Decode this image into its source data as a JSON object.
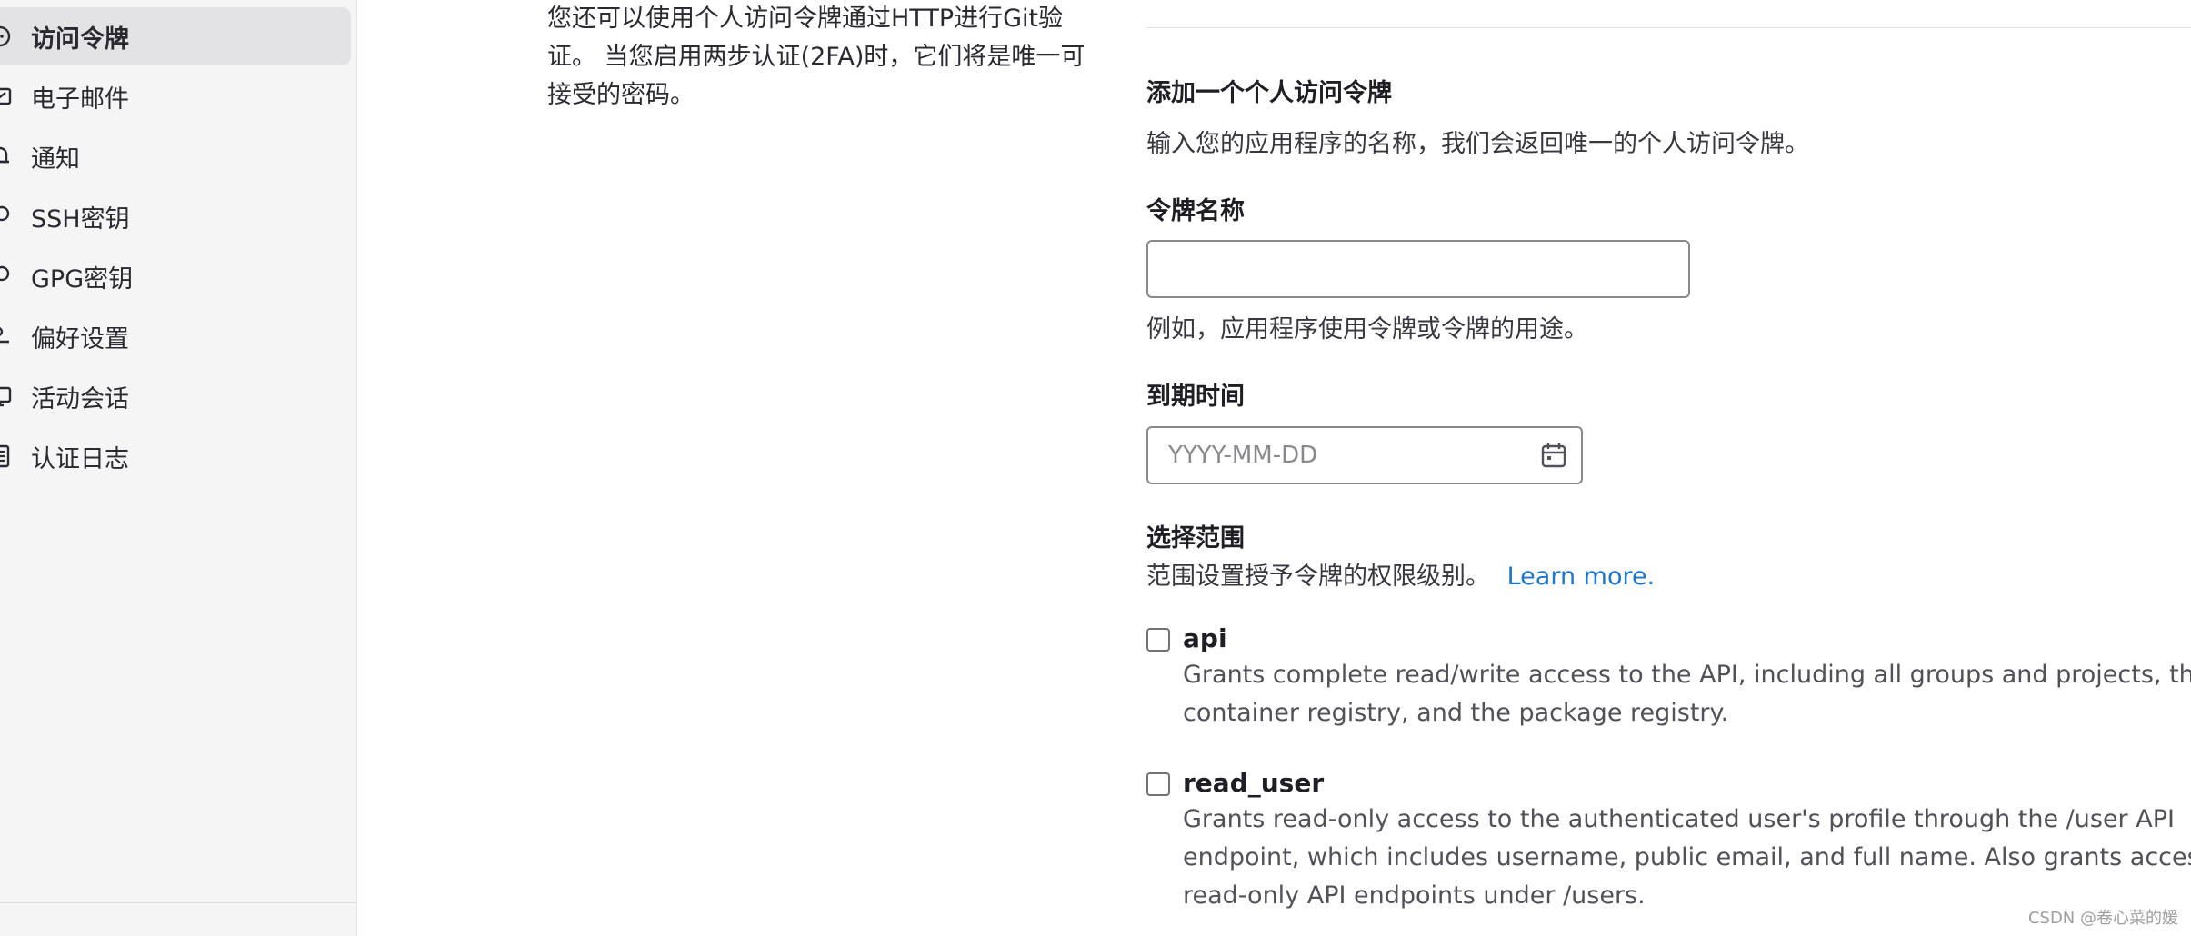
{
  "sidebar": {
    "items": [
      {
        "label": "访问令牌",
        "icon": "token-icon",
        "active": true
      },
      {
        "label": "电子邮件",
        "icon": "mail-icon",
        "active": false
      },
      {
        "label": "通知",
        "icon": "bell-icon",
        "active": false
      },
      {
        "label": "SSH密钥",
        "icon": "key-icon",
        "active": false
      },
      {
        "label": "GPG密钥",
        "icon": "key-icon",
        "active": false
      },
      {
        "label": "偏好设置",
        "icon": "preferences-icon",
        "active": false
      },
      {
        "label": "活动会话",
        "icon": "monitor-icon",
        "active": false
      },
      {
        "label": "认证日志",
        "icon": "log-icon",
        "active": false
      }
    ]
  },
  "intro": {
    "text": "您还可以使用个人访问令牌通过HTTP进行Git验证。 当您启用两步认证(2FA)时，它们将是唯一可接受的密码。"
  },
  "form": {
    "title": "添加一个个人访问令牌",
    "subtitle": "输入您的应用程序的名称，我们会返回唯一的个人访问令牌。",
    "token_name": {
      "label": "令牌名称",
      "value": "",
      "help": "例如，应用程序使用令牌或令牌的用途。"
    },
    "expiry": {
      "label": "到期时间",
      "placeholder": "YYYY-MM-DD"
    },
    "scopes": {
      "title": "选择范围",
      "help": "范围设置授予令牌的权限级别。",
      "learn_more": "Learn more.",
      "items": [
        {
          "name": "api",
          "checked": false,
          "desc": "Grants complete read/write access to the API, including all groups and projects, the container registry, and the package registry."
        },
        {
          "name": "read_user",
          "checked": false,
          "desc": "Grants read-only access to the authenticated user's profile through the /user API endpoint, which includes username, public email, and full name. Also grants access to read-only API endpoints under /users."
        }
      ]
    }
  },
  "watermark": "CSDN @卷心菜的媛"
}
